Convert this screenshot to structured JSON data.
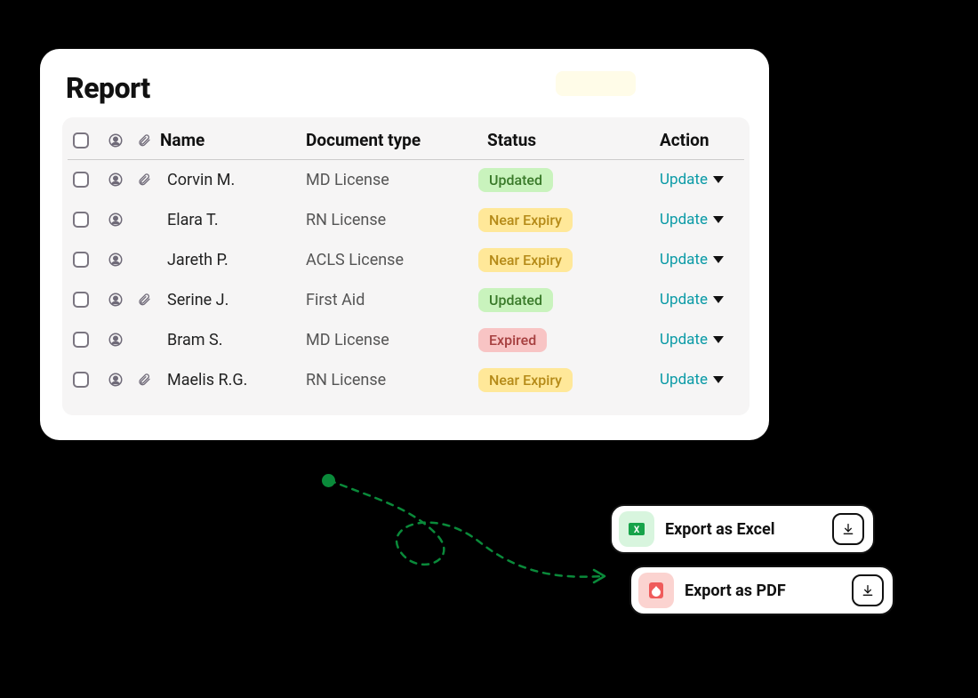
{
  "title": "Report",
  "columns": {
    "name": "Name",
    "doc": "Document type",
    "status": "Status",
    "action": "Action"
  },
  "action_label": "Update",
  "status_styles": {
    "Updated": "b-updated",
    "Near Expiry": "b-near",
    "Expired": "b-expired"
  },
  "rows": [
    {
      "name": "Corvin M.",
      "doc": "MD License",
      "status": "Updated",
      "has_attach": true
    },
    {
      "name": "Elara T.",
      "doc": "RN License",
      "status": "Near Expiry",
      "has_attach": false
    },
    {
      "name": "Jareth P.",
      "doc": "ACLS License",
      "status": "Near Expiry",
      "has_attach": false
    },
    {
      "name": "Serine J.",
      "doc": "First Aid",
      "status": "Updated",
      "has_attach": true
    },
    {
      "name": "Bram S.",
      "doc": "MD License",
      "status": "Expired",
      "has_attach": false
    },
    {
      "name": "Maelis R.G.",
      "doc": "RN License",
      "status": "Near Expiry",
      "has_attach": true
    }
  ],
  "export": {
    "excel": "Export as Excel",
    "pdf": "Export as PDF"
  }
}
